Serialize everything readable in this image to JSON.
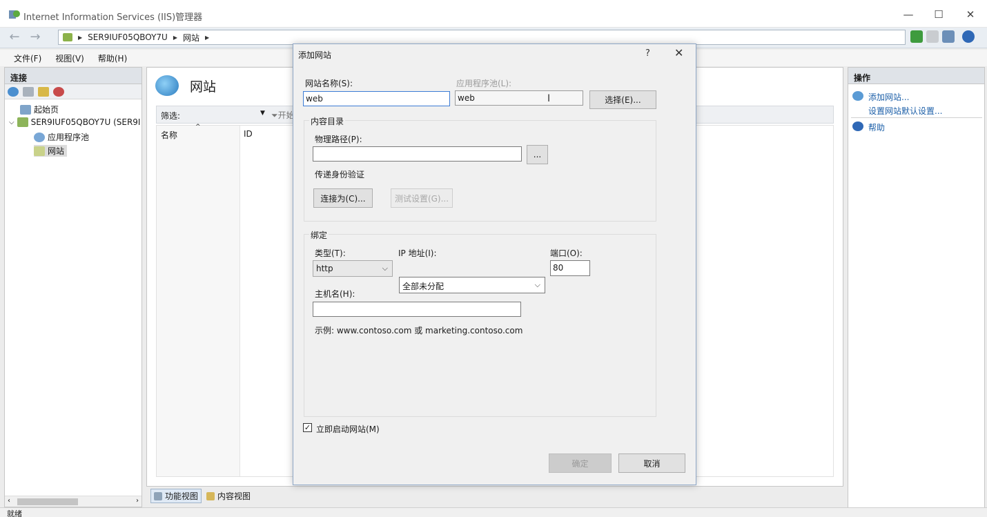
{
  "window": {
    "title": "Internet Information Services (IIS)管理器"
  },
  "address": {
    "crumbs": [
      "SER9IUF05QBOY7U",
      "网站"
    ]
  },
  "menu": {
    "file": "文件(F)",
    "view": "视图(V)",
    "help": "帮助(H)"
  },
  "left": {
    "header": "连接",
    "tree": {
      "start": "起始页",
      "server": "SER9IUF05QBOY7U (SER9I",
      "apppools": "应用程序池",
      "sites": "网站"
    }
  },
  "center": {
    "title": "网站",
    "filter_label": "筛选:",
    "filter_go": "开始",
    "col_name": "名称",
    "col_id": "ID",
    "tab_features": "功能视图",
    "tab_content": "内容视图"
  },
  "right": {
    "header": "操作",
    "add_site": "添加网站...",
    "set_defaults": "设置网站默认设置...",
    "help": "帮助"
  },
  "status": {
    "text": "就绪"
  },
  "dialog": {
    "title": "添加网站",
    "help_glyph": "?",
    "close_glyph": "✕",
    "site_name_label": "网站名称(S):",
    "site_name_value": "web",
    "app_pool_label": "应用程序池(L):",
    "app_pool_value": "web",
    "select_button": "选择(E)...",
    "content_dir_label": "内容目录",
    "physical_path_label": "物理路径(P):",
    "physical_path_value": "",
    "browse_button": "...",
    "passthrough_label": "传递身份验证",
    "connect_as_button": "连接为(C)...",
    "test_settings_button": "测试设置(G)...",
    "binding_label": "绑定",
    "type_label": "类型(T):",
    "type_value": "http",
    "ip_label": "IP 地址(I):",
    "ip_value": "全部未分配",
    "port_label": "端口(O):",
    "port_value": "80",
    "host_label": "主机名(H):",
    "host_value": "",
    "example_text": "示例: www.contoso.com 或 marketing.contoso.com",
    "start_now_label": "立即启动网站(M)",
    "start_now_checked": "✓",
    "ok_button": "确定",
    "cancel_button": "取消"
  },
  "colors": {
    "link": "#1c5fa8",
    "accent": "#3b7bd4"
  }
}
